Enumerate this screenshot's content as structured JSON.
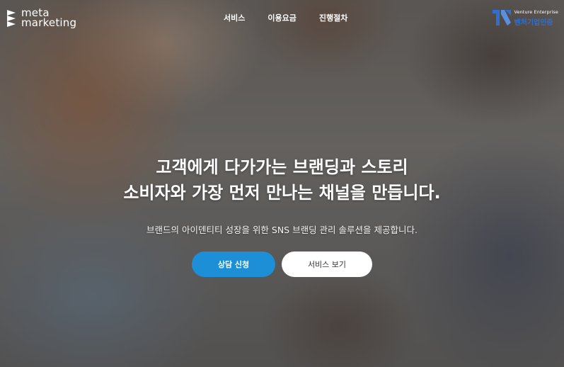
{
  "brand": {
    "logo_line1": "meta",
    "logo_line2": "marketing"
  },
  "nav": {
    "items": [
      "서비스",
      "이용요금",
      "진행절차"
    ]
  },
  "badge": {
    "english": "Venture Enterprise",
    "korean": "벤처기업인증"
  },
  "hero": {
    "headline_line1": "고객에게 다가가는 브랜딩과 스토리",
    "headline_line2": "소비자와 가장 먼저 만나는 채널을 만듭니다.",
    "subtext": "브랜드의 아이덴티티 성장을 위한 SNS 브랜딩 관리 솔루션을 제공합니다."
  },
  "cta": {
    "primary_label": "상담 신청",
    "secondary_label": "서비스 보기"
  },
  "colors": {
    "primary_button": "#1d8fd6",
    "secondary_button": "#ffffff",
    "badge_text": "#2f6fd0"
  }
}
